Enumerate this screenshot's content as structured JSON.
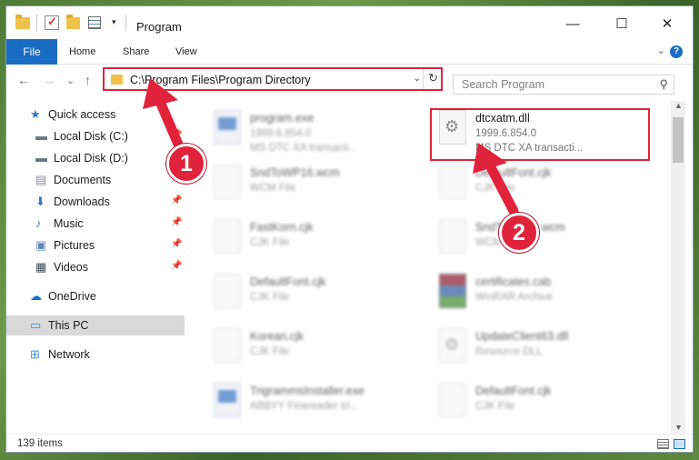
{
  "window": {
    "title": "Program",
    "qa_dropdown": "▾",
    "controls": {
      "minimize": "—",
      "maximize": "☐",
      "close": "✕"
    }
  },
  "ribbon": {
    "tabs": [
      "File",
      "Home",
      "Share",
      "View"
    ],
    "collapse": "⌄",
    "help": "?"
  },
  "nav": {
    "back": "←",
    "forward": "→",
    "recent": "⌄",
    "up": "↑",
    "address": "C:\\Program Files\\Program Directory",
    "address_dropdown": "⌄",
    "refresh": "↻",
    "search_placeholder": "Search Program",
    "search_icon": "⚲"
  },
  "sidebar": {
    "items": [
      {
        "label": "Quick access",
        "icon": "star-icon",
        "pinned": false
      },
      {
        "label": "Local Disk (C:)",
        "icon": "drive-icon",
        "pinned": true
      },
      {
        "label": "Local Disk (D:)",
        "icon": "drive-icon",
        "pinned": true
      },
      {
        "label": "Documents",
        "icon": "documents-icon",
        "pinned": true
      },
      {
        "label": "Downloads",
        "icon": "download-icon",
        "pinned": true
      },
      {
        "label": "Music",
        "icon": "music-icon",
        "pinned": true
      },
      {
        "label": "Pictures",
        "icon": "pictures-icon",
        "pinned": true
      },
      {
        "label": "Videos",
        "icon": "videos-icon",
        "pinned": true
      },
      {
        "label": "OneDrive",
        "icon": "cloud-icon",
        "pinned": false
      },
      {
        "label": "This PC",
        "icon": "computer-icon",
        "pinned": false,
        "selected": true
      },
      {
        "label": "Network",
        "icon": "network-icon",
        "pinned": false
      }
    ],
    "pin_glyph": "📌"
  },
  "files": [
    {
      "name": "program.exe",
      "line1": "1999.6.854.0",
      "line2": "MS DTC XA transacti...",
      "icon": "exe-icon",
      "blurred": true
    },
    {
      "name": "dtcxatm.dll",
      "line1": "1999.6.854.0",
      "line2": "MS DTC XA transacti...",
      "icon": "dll-icon",
      "blurred": false,
      "highlighted": true
    },
    {
      "name": "SndToWP16.wcm",
      "line1": "WCM File",
      "line2": "",
      "icon": "file-icon",
      "blurred": true
    },
    {
      "name": "DefaultFont.cjk",
      "line1": "CJK File",
      "line2": "",
      "icon": "file-icon",
      "blurred": true
    },
    {
      "name": "FastKorn.cjk",
      "line1": "CJK File",
      "line2": "",
      "icon": "file-icon",
      "blurred": true
    },
    {
      "name": "SndToWP32.wcm",
      "line1": "WCM File",
      "line2": "",
      "icon": "file-icon",
      "blurred": true
    },
    {
      "name": "DefaultFont.cjk",
      "line1": "CJK File",
      "line2": "",
      "icon": "file-icon",
      "blurred": true
    },
    {
      "name": "certificates.cab",
      "line1": "WinRAR Archive",
      "line2": "",
      "icon": "rar-icon",
      "blurred": true
    },
    {
      "name": "Korean.cjk",
      "line1": "CJK File",
      "line2": "",
      "icon": "file-icon",
      "blurred": true
    },
    {
      "name": "UpdateClient63.dll",
      "line1": "Resource DLL",
      "line2": "",
      "icon": "dll-icon",
      "blurred": true
    },
    {
      "name": "TrigrammsInstaller.exe",
      "line1": "ABBYY Finereader tri...",
      "line2": "",
      "icon": "exe-icon",
      "blurred": true
    },
    {
      "name": "DefaultFont.cjk",
      "line1": "CJK File",
      "line2": "",
      "icon": "file-icon",
      "blurred": true
    }
  ],
  "scrollbar": {
    "up": "▲",
    "down": "▼"
  },
  "status": {
    "count": "139 items"
  },
  "callouts": [
    {
      "label": "1"
    },
    {
      "label": "2"
    }
  ],
  "colors": {
    "accent": "#1a6cc2",
    "callout": "#e0233a",
    "folder": "#f1c24b"
  }
}
